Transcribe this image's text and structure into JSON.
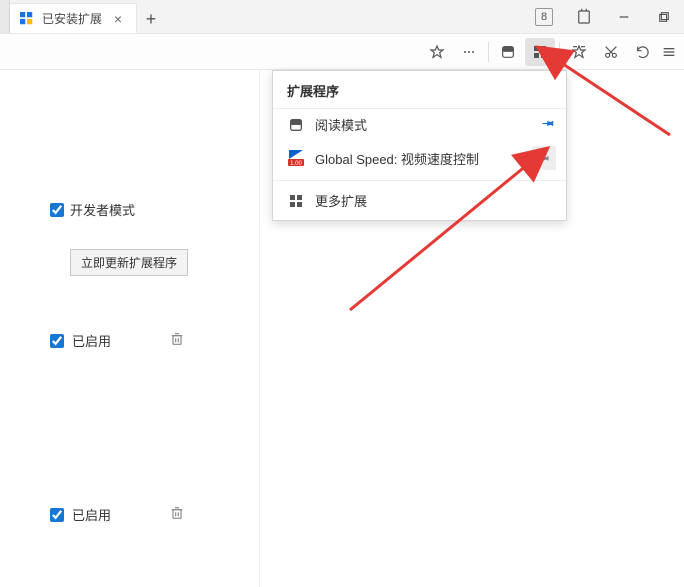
{
  "titlebar": {
    "tab_title": "已安装扩展",
    "badge_count": "8"
  },
  "popup": {
    "header": "扩展程序",
    "items": [
      {
        "label": "阅读模式"
      },
      {
        "label": "Global Speed: 视频速度控制"
      }
    ],
    "more": "更多扩展"
  },
  "sidebar": {
    "dev_mode_label": "开发者模式",
    "update_button": "立即更新扩展程序",
    "enabled_label_1": "已启用",
    "enabled_label_2": "已启用"
  }
}
